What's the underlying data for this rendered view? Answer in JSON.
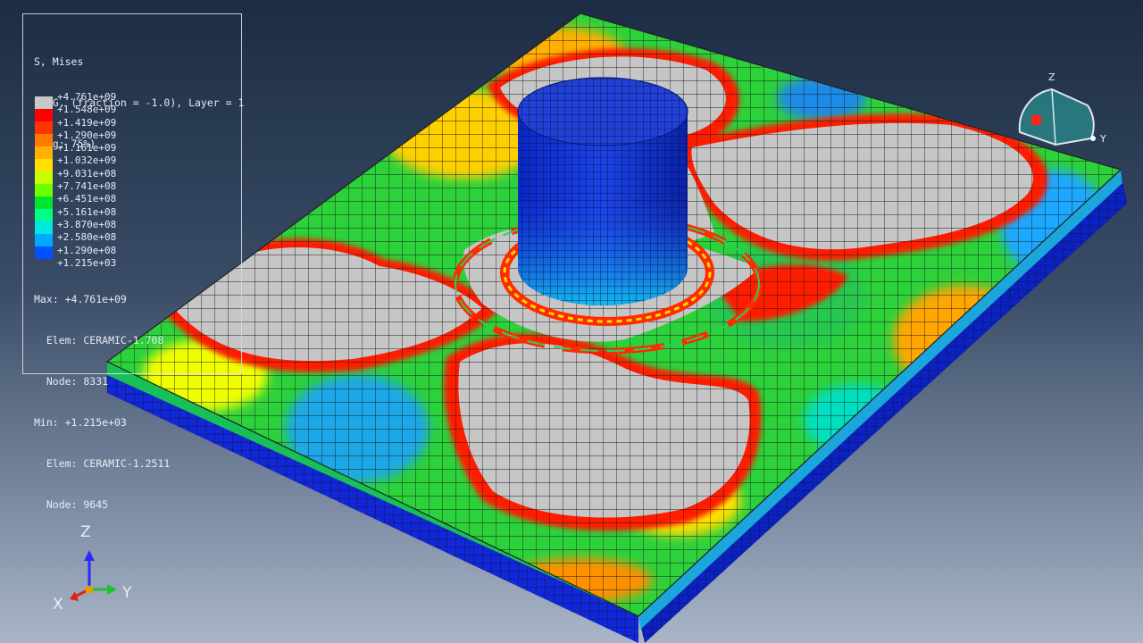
{
  "legend": {
    "variable": "S, Mises",
    "section": "SNEG, (fraction = -1.0), Layer = 1",
    "averaging": "(Avg: 75%)",
    "levels": [
      {
        "label": "+4.761e+09",
        "color": "#c8c8c8"
      },
      {
        "label": "+1.548e+09",
        "color": "#ff0000"
      },
      {
        "label": "+1.419e+09",
        "color": "#ff3300"
      },
      {
        "label": "+1.290e+09",
        "color": "#ff7a00"
      },
      {
        "label": "+1.161e+09",
        "color": "#ffb000"
      },
      {
        "label": "+1.032e+09",
        "color": "#ffe000"
      },
      {
        "label": "+9.031e+08",
        "color": "#c8ff00"
      },
      {
        "label": "+7.741e+08",
        "color": "#6eff00"
      },
      {
        "label": "+6.451e+08",
        "color": "#00e62e"
      },
      {
        "label": "+5.161e+08",
        "color": "#00ff88"
      },
      {
        "label": "+3.870e+08",
        "color": "#00e6e0"
      },
      {
        "label": "+2.580e+08",
        "color": "#00a8ff"
      },
      {
        "label": "+1.290e+08",
        "color": "#0050ff"
      },
      {
        "label": "+1.215e+03",
        "color": "#0000d8"
      }
    ],
    "max_line": "Max: +4.761e+09",
    "max_elem": "  Elem: CERAMIC-1.708",
    "max_node": "  Node: 8331",
    "min_line": "Min: +1.215e+03",
    "min_elem": "  Elem: CERAMIC-1.2511",
    "min_node": "  Node: 9645"
  },
  "triad": {
    "x": "X",
    "y": "Y",
    "z": "Z"
  },
  "view_cube": {
    "y": "Y",
    "z": "Z"
  }
}
